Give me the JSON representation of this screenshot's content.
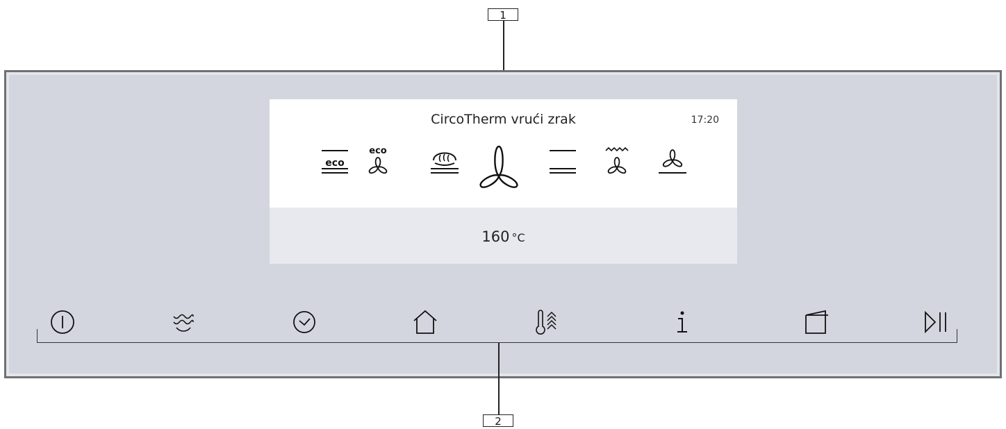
{
  "callouts": {
    "one": "1",
    "two": "2"
  },
  "display": {
    "title": "CircoTherm vrući zrak",
    "time": "17:20",
    "temperature_value": "160",
    "temperature_unit": "°C",
    "eco_label": "eco",
    "modes": [
      "top-bottom-heat-eco",
      "circotherm-eco",
      "pizza-setting",
      "circotherm-hot-air-selected",
      "top-bottom-heating",
      "grill-fan",
      "bottom-heat-fan"
    ]
  },
  "touch_keys": [
    "power-icon",
    "steam-icon",
    "timer-icon",
    "home-icon",
    "rapid-heat-icon",
    "info-icon",
    "door-icon",
    "start-pause-icon"
  ],
  "colors": {
    "panel": "#d3d6de",
    "frame": "#6f7073",
    "display_bg": "#ffffff",
    "temp_area": "#e8e9ee"
  }
}
